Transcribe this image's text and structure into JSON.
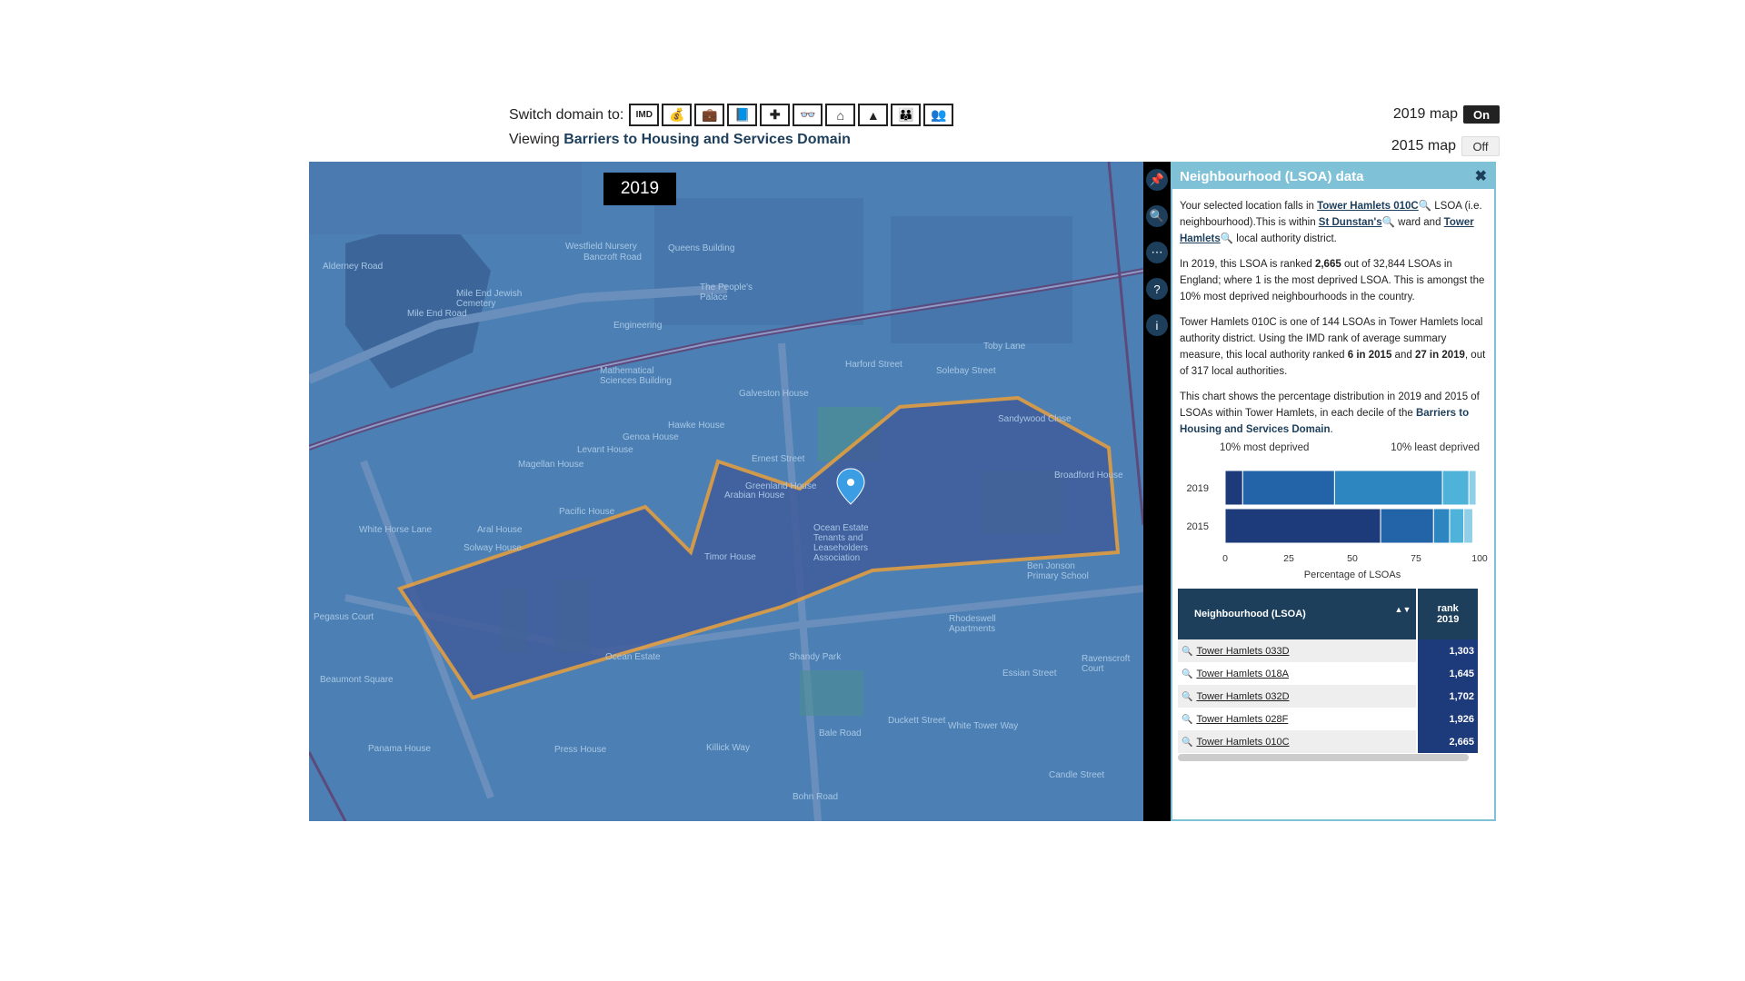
{
  "header": {
    "switch_label": "Switch domain to:",
    "domain_icons": [
      {
        "name": "imd-icon",
        "glyph": "IMD"
      },
      {
        "name": "income-icon",
        "glyph": "💰"
      },
      {
        "name": "employment-icon",
        "glyph": "💼"
      },
      {
        "name": "education-icon",
        "glyph": "📘"
      },
      {
        "name": "health-icon",
        "glyph": "✚"
      },
      {
        "name": "crime-icon",
        "glyph": "👓"
      },
      {
        "name": "housing-icon",
        "glyph": "⌂"
      },
      {
        "name": "environment-icon",
        "glyph": "▲"
      },
      {
        "name": "children-icon",
        "glyph": "👪"
      },
      {
        "name": "older-people-icon",
        "glyph": "👥"
      }
    ],
    "viewing_prefix": "Viewing",
    "viewing_domain": "Barriers to Housing and Services Domain"
  },
  "map_toggles": {
    "map2019_label": "2019 map",
    "map2019_state": "On",
    "map2015_label": "2015 map",
    "map2015_state": "Off"
  },
  "map": {
    "year_badge": "2019",
    "labels": [
      {
        "t": "Alderney Road"
      },
      {
        "t": "Mile End Jewish Cemetery"
      },
      {
        "t": "Mile End Road"
      },
      {
        "t": "Westfield Nursery"
      },
      {
        "t": "Bancroft Road"
      },
      {
        "t": "Queens Building"
      },
      {
        "t": "The People's Palace"
      },
      {
        "t": "Engineering"
      },
      {
        "t": "Mathematical Sciences Building"
      },
      {
        "t": "Galveston House"
      },
      {
        "t": "Harford Street"
      },
      {
        "t": "Toby Lane"
      },
      {
        "t": "Solebay Street"
      },
      {
        "t": "Hawke House"
      },
      {
        "t": "Genoa House"
      },
      {
        "t": "Levant House"
      },
      {
        "t": "Magellan House"
      },
      {
        "t": "Ernest Street"
      },
      {
        "t": "Greenland House"
      },
      {
        "t": "Arabian House"
      },
      {
        "t": "Sandywood Close"
      },
      {
        "t": "Broadford House"
      },
      {
        "t": "Ocean Estate Tenants and Leaseholders Association"
      },
      {
        "t": "Ben Jonson Primary School"
      },
      {
        "t": "Timor House"
      },
      {
        "t": "Pacific House"
      },
      {
        "t": "Aral House"
      },
      {
        "t": "Solway House"
      },
      {
        "t": "White Horse Lane"
      },
      {
        "t": "Ocean Estate"
      },
      {
        "t": "Shandy Park"
      },
      {
        "t": "Rhodeswell Apartments"
      },
      {
        "t": "Essian Street"
      },
      {
        "t": "Bale Road"
      },
      {
        "t": "Duckett Street"
      },
      {
        "t": "Killick Way"
      },
      {
        "t": "White Tower Way"
      },
      {
        "t": "Bohn Road"
      },
      {
        "t": "Press House"
      },
      {
        "t": "Beaumont Square"
      },
      {
        "t": "Panama House"
      },
      {
        "t": "Ravenscroft Court"
      },
      {
        "t": "Candle Street"
      },
      {
        "t": "Pegasus Court"
      }
    ]
  },
  "tools": [
    {
      "name": "pin-icon",
      "glyph": "📌"
    },
    {
      "name": "zoom-icon",
      "glyph": "🔍"
    },
    {
      "name": "grid-icon",
      "glyph": "⋯"
    },
    {
      "name": "help-icon",
      "glyph": "?"
    },
    {
      "name": "info-icon",
      "glyph": "i"
    }
  ],
  "panel": {
    "title": "Neighbourhood (LSOA) data",
    "close": "✖",
    "p1": {
      "a": "Your selected location falls in",
      "lsoa": "Tower Hamlets 010C",
      "b": "LSOA (i.e. neighbourhood).This is within",
      "ward": "St Dunstan's",
      "c": "ward and",
      "la": "Tower Hamlets",
      "d": "local authority district."
    },
    "p2": {
      "a": "In 2019, this LSOA is ranked",
      "rank": "2,665",
      "b": "out of 32,844 LSOAs in England; where 1 is the most deprived LSOA. This is amongst the 10% most deprived neighbourhoods in the country."
    },
    "p3": {
      "a": "Tower Hamlets 010C is one of 144 LSOAs in Tower Hamlets local authority district. Using the IMD rank of average summary measure, this local authority ranked",
      "r2015": "6 in 2015",
      "b": "and",
      "r2019": "27 in 2019",
      "c": ", out of 317 local authorities."
    },
    "p4": {
      "a": "This chart shows the percentage distribution in 2019 and 2015 of LSOAs within Tower Hamlets, in each decile of the",
      "domain": "Barriers to Housing and Services Domain",
      "b": "."
    },
    "table": {
      "col1": "Neighbourhood (LSOA)",
      "col2a": "rank",
      "col2b": "2019",
      "rows": [
        {
          "name": "Tower Hamlets 033D",
          "rank": "1,303"
        },
        {
          "name": "Tower Hamlets 018A",
          "rank": "1,645"
        },
        {
          "name": "Tower Hamlets 032D",
          "rank": "1,702"
        },
        {
          "name": "Tower Hamlets 028F",
          "rank": "1,926"
        },
        {
          "name": "Tower Hamlets 010C",
          "rank": "2,665"
        }
      ]
    }
  },
  "chart_data": {
    "type": "bar",
    "orientation": "horizontal-stacked",
    "legend_left": "10% most deprived",
    "legend_right": "10% least deprived",
    "categories": [
      "2019",
      "2015"
    ],
    "xlabel": "Percentage of LSOAs",
    "xlim": [
      0,
      100
    ],
    "xticks": [
      0,
      25,
      50,
      75,
      100
    ],
    "segment_colors": [
      "#1d3a7a",
      "#2363a8",
      "#2e86c1",
      "#4fb3d9",
      "#8fd0e8"
    ],
    "series": [
      {
        "values": [
          6.9,
          36.1,
          42.4,
          10.4,
          2.8
        ]
      },
      {
        "values": [
          61.1,
          20.8,
          6.3,
          5.6,
          3.5
        ]
      }
    ]
  }
}
